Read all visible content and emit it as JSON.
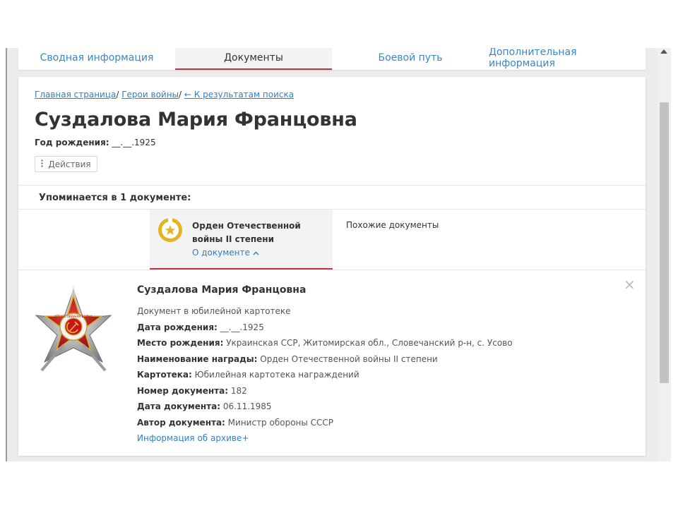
{
  "tabs": [
    {
      "label": "Сводная информация"
    },
    {
      "label": "Документы"
    },
    {
      "label": "Боевой путь"
    },
    {
      "label": "Дополнительная информация"
    }
  ],
  "breadcrumb": {
    "home": "Главная страница",
    "sep1": "/ ",
    "heroes": "Герои войны",
    "sep2": "/ ",
    "back": "← К результатам поиска"
  },
  "person": {
    "name": "Суздалова Мария Францовна",
    "birth_label": "Год рождения:",
    "birth_value": "__.__.1925"
  },
  "actions_label": "Действия",
  "mention_text": "Упоминается в 1 документе:",
  "document_tab": {
    "title": "Орден Отечественной войны II степени",
    "about_link": "О документе",
    "similar": "Похожие документы"
  },
  "details": {
    "name": "Суздалова Мария Францовна",
    "type": "Документ в юбилейной картотеке",
    "rows": [
      {
        "label": "Дата рождения:",
        "value": "__.__.1925"
      },
      {
        "label": "Место рождения:",
        "value": "Украинская ССР, Житомирская обл., Словечанский р-н, с. Усово"
      },
      {
        "label": "Наименование награды:",
        "value": "Орден Отечественной войны II степени"
      },
      {
        "label": "Картотека:",
        "value": "Юбилейная картотека награждений"
      },
      {
        "label": "Номер документа:",
        "value": "182"
      },
      {
        "label": "Дата документа:",
        "value": "06.11.1985"
      },
      {
        "label": "Автор документа:",
        "value": "Министр обороны СССР"
      }
    ],
    "archive_link": "Информация об архиве+"
  },
  "order_emblem_text": "ОТЕЧЕСТВЕННАЯ ВОЙНА",
  "icons": {
    "actions": "vertical-dots-icon",
    "about": "chevron-up-icon",
    "close": "close-icon",
    "scroll_top": "chevron-up-icon"
  },
  "colors": {
    "link": "#2f80c4",
    "active_underline": "#c4343c",
    "medal_gold": "#e2b422"
  }
}
